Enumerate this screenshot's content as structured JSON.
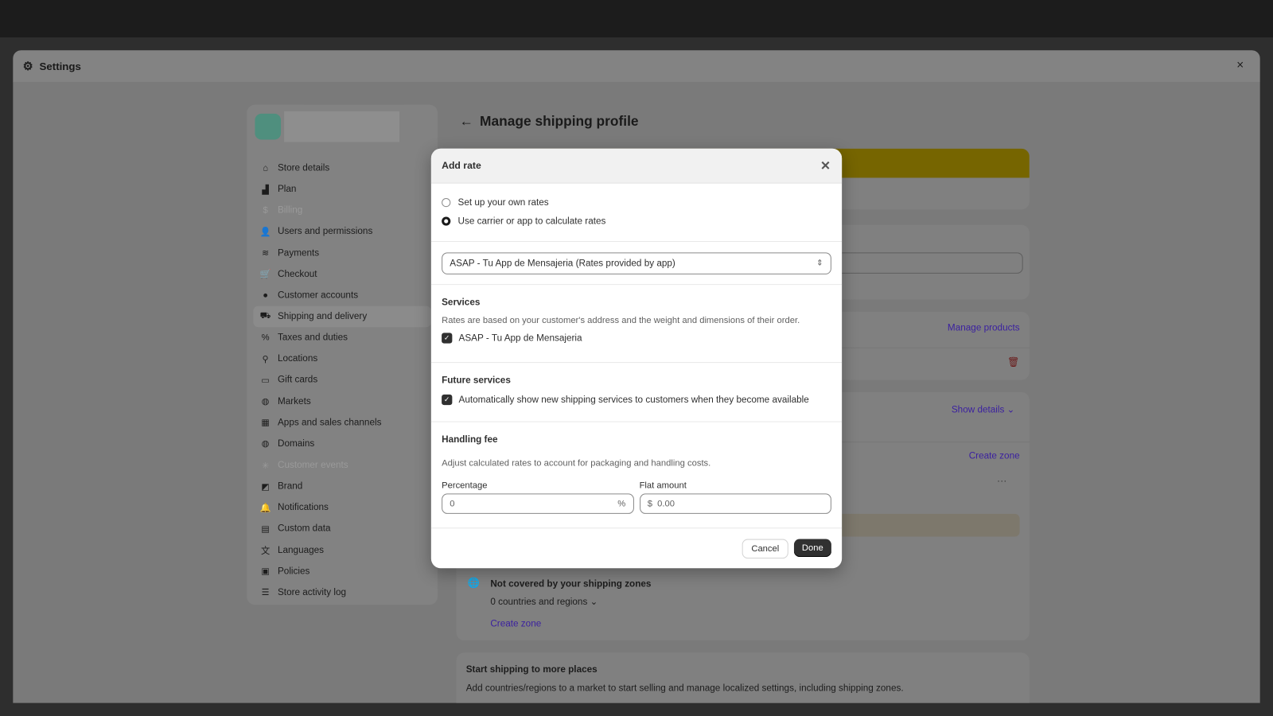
{
  "window": {
    "title": "Settings",
    "close": "×"
  },
  "sidebar": {
    "items": [
      {
        "label": "Store details",
        "icon": "store-icon",
        "state": "normal"
      },
      {
        "label": "Plan",
        "icon": "plan-icon",
        "state": "normal"
      },
      {
        "label": "Billing",
        "icon": "billing-icon",
        "state": "disabled"
      },
      {
        "label": "Users and permissions",
        "icon": "users-icon",
        "state": "normal"
      },
      {
        "label": "Payments",
        "icon": "payments-icon",
        "state": "normal"
      },
      {
        "label": "Checkout",
        "icon": "cart-icon",
        "state": "normal"
      },
      {
        "label": "Customer accounts",
        "icon": "person-icon",
        "state": "normal"
      },
      {
        "label": "Shipping and delivery",
        "icon": "truck-icon",
        "state": "active"
      },
      {
        "label": "Taxes and duties",
        "icon": "tax-icon",
        "state": "normal"
      },
      {
        "label": "Locations",
        "icon": "location-icon",
        "state": "normal"
      },
      {
        "label": "Gift cards",
        "icon": "gift-card-icon",
        "state": "normal"
      },
      {
        "label": "Markets",
        "icon": "globe-icon",
        "state": "normal"
      },
      {
        "label": "Apps and sales channels",
        "icon": "apps-icon",
        "state": "normal"
      },
      {
        "label": "Domains",
        "icon": "globe-icon",
        "state": "normal"
      },
      {
        "label": "Customer events",
        "icon": "events-icon",
        "state": "disabled"
      },
      {
        "label": "Brand",
        "icon": "brand-icon",
        "state": "normal"
      },
      {
        "label": "Notifications",
        "icon": "bell-icon",
        "state": "normal"
      },
      {
        "label": "Custom data",
        "icon": "data-icon",
        "state": "normal"
      },
      {
        "label": "Languages",
        "icon": "language-icon",
        "state": "normal"
      },
      {
        "label": "Policies",
        "icon": "policy-icon",
        "state": "normal"
      },
      {
        "label": "Store activity log",
        "icon": "list-icon",
        "state": "normal"
      }
    ]
  },
  "page": {
    "title": "Manage shipping profile",
    "manage_products": "Manage products",
    "show_details": "Show details",
    "create_zone": "Create zone",
    "not_covered": "Not covered by your shipping zones",
    "countries": "0 countries and regions",
    "create_zone2": "Create zone",
    "more_title": "Start shipping to more places",
    "more_desc": "Add countries/regions to a market to start selling and manage localized settings, including shipping zones.",
    "banner_color": "#766500"
  },
  "modal": {
    "title": "Add rate",
    "option_own": "Set up your own rates",
    "option_carrier": "Use carrier or app to calculate rates",
    "selected_option": "carrier",
    "carrier_select": "ASAP - Tu App de Mensajeria (Rates provided by app)",
    "services_title": "Services",
    "services_desc": "Rates are based on your customer's address and the weight and dimensions of their order.",
    "service_item": "ASAP - Tu App de Mensajeria",
    "service_checked": true,
    "future_title": "Future services",
    "future_item": "Automatically show new shipping services to customers when they become available",
    "future_checked": true,
    "fee_title": "Handling fee",
    "fee_desc": "Adjust calculated rates to account for packaging and handling costs.",
    "percentage_label": "Percentage",
    "percentage_placeholder": "0",
    "percentage_suffix": "%",
    "flat_label": "Flat amount",
    "flat_prefix": "$",
    "flat_placeholder": "0.00",
    "cancel": "Cancel",
    "done": "Done"
  }
}
